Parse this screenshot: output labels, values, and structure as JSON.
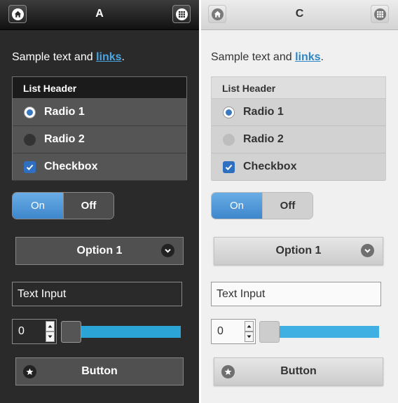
{
  "accent": "#3b78c2",
  "slider_color": "#2ba5d6",
  "panels": [
    {
      "title": "A",
      "home_icon": "home-icon",
      "grid_icon": "grid-icon",
      "sample_text": "Sample text and ",
      "link_text": "links",
      "sample_end": ".",
      "list_header": "List Header",
      "radio1": "Radio 1",
      "radio2": "Radio 2",
      "checkbox": "Checkbox",
      "toggle_on": "On",
      "toggle_off": "Off",
      "select_value": "Option 1",
      "text_input": "Text Input",
      "number_value": "0",
      "slider_value": 0,
      "button_label": "Button"
    },
    {
      "title": "C",
      "home_icon": "home-icon",
      "grid_icon": "grid-icon",
      "sample_text": "Sample text and ",
      "link_text": "links",
      "sample_end": ".",
      "list_header": "List Header",
      "radio1": "Radio 1",
      "radio2": "Radio 2",
      "checkbox": "Checkbox",
      "toggle_on": "On",
      "toggle_off": "Off",
      "select_value": "Option 1",
      "text_input": "Text Input",
      "number_value": "0",
      "slider_value": 0,
      "button_label": "Button"
    }
  ]
}
